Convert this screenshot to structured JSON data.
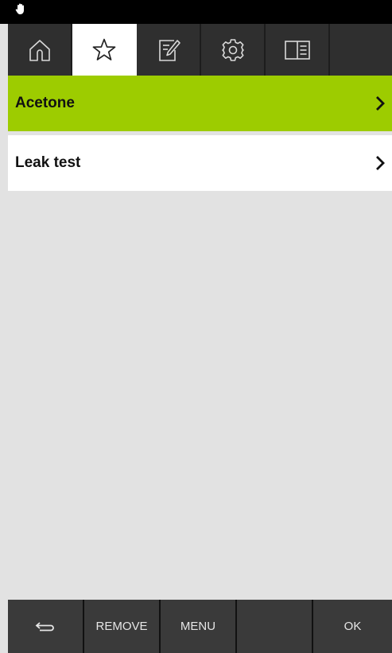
{
  "status_bar": {
    "icon": "hand-icon"
  },
  "tabs": [
    {
      "icon": "home-icon",
      "active": false
    },
    {
      "icon": "star-icon",
      "active": true
    },
    {
      "icon": "edit-icon",
      "active": false
    },
    {
      "icon": "gear-icon",
      "active": false
    },
    {
      "icon": "manual-icon",
      "active": false
    },
    {
      "icon": "",
      "active": false
    }
  ],
  "list": {
    "items": [
      {
        "label": "Acetone",
        "selected": true
      },
      {
        "label": "Leak test",
        "selected": false
      }
    ]
  },
  "footer": {
    "back_icon": "back-arrow-icon",
    "remove_label": "REMOVE",
    "menu_label": "MENU",
    "empty_label": "",
    "ok_label": "OK"
  },
  "colors": {
    "accent": "#9dcc00",
    "toolbar": "#2f2f2f",
    "footer": "#3a3a3a",
    "background": "#e2e2e2"
  }
}
